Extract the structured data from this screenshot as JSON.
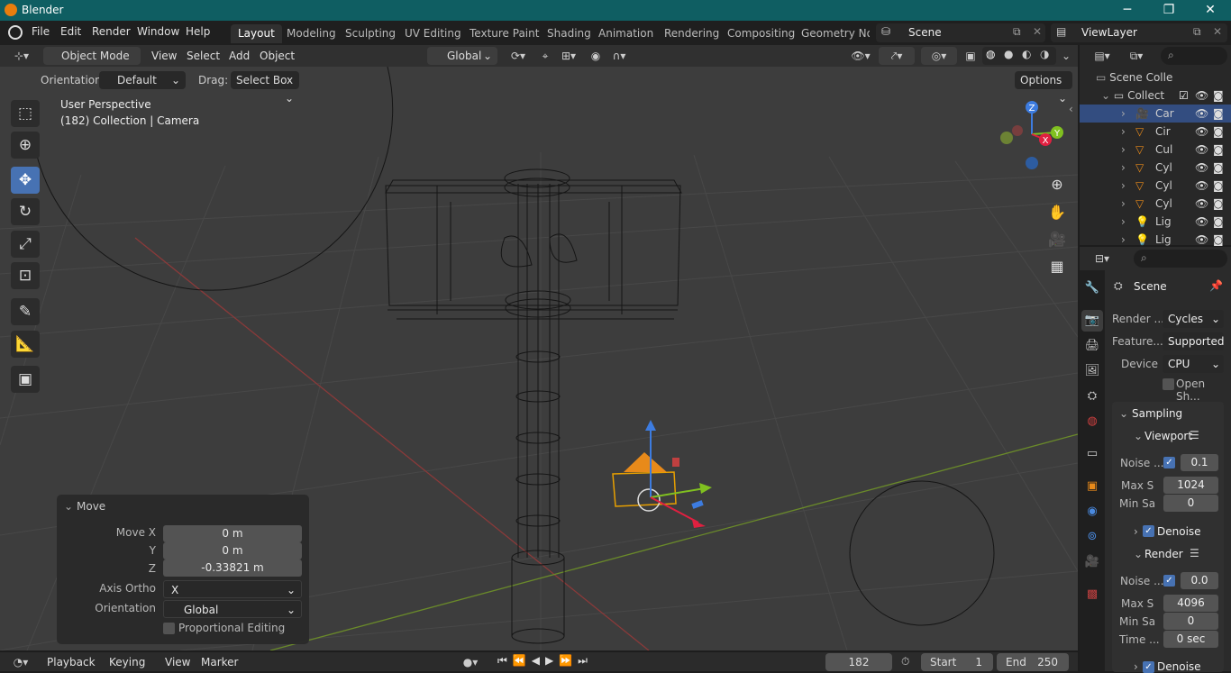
{
  "app": {
    "title": "Blender",
    "win_min": "─",
    "win_max": "❐",
    "win_close": "✕"
  },
  "menu": [
    "File",
    "Edit",
    "Render",
    "Window",
    "Help"
  ],
  "workspaces": [
    "Layout",
    "Modeling",
    "Sculpting",
    "UV Editing",
    "Texture Paint",
    "Shading",
    "Animation",
    "Rendering",
    "Compositing",
    "Geometry Noc"
  ],
  "scene_name": "Scene",
  "view_layer": "ViewLayer",
  "header3d": {
    "mode": "Object Mode",
    "menus": [
      "View",
      "Select",
      "Add",
      "Object"
    ],
    "transform": "Global"
  },
  "header3d2": {
    "orientation_label": "Orientation:",
    "orientation_value": "Default",
    "drag_label": "Drag:",
    "drag_value": "Select Box",
    "options": "Options"
  },
  "viewport": {
    "perspective": "User Perspective",
    "context": "(182) Collection | Camera"
  },
  "gizmo": {
    "z": "Z",
    "y": "Y",
    "x": "X"
  },
  "operator_panel": {
    "title": "Move",
    "move_x_label": "Move X",
    "move_x": "0 m",
    "y_label": "Y",
    "y": "0 m",
    "z_label": "Z",
    "z": "-0.33821 m",
    "axis_ortho_label": "Axis Ortho",
    "axis_ortho": "X",
    "orientation_label": "Orientation",
    "orientation": "Global",
    "proportional": "Proportional Editing"
  },
  "timeline": {
    "menus": [
      "Playback",
      "Keying",
      "View",
      "Marker"
    ],
    "frame": "182",
    "start_label": "Start",
    "start": "1",
    "end_label": "End",
    "end": "250"
  },
  "outliner": {
    "root": "Scene Colle",
    "collection": "Collect",
    "items": [
      {
        "name": "Car",
        "icon": "camera-icon",
        "selected": true
      },
      {
        "name": "Cir",
        "icon": "mesh-icon"
      },
      {
        "name": "Cul",
        "icon": "mesh-icon"
      },
      {
        "name": "Cyl",
        "icon": "mesh-icon"
      },
      {
        "name": "Cyl",
        "icon": "mesh-icon"
      },
      {
        "name": "Cyl",
        "icon": "mesh-icon"
      },
      {
        "name": "Lig",
        "icon": "light-icon"
      },
      {
        "name": "Lig",
        "icon": "light-icon"
      }
    ]
  },
  "properties": {
    "context": "Scene",
    "render_engine_label": "Render ...",
    "render_engine": "Cycles",
    "feature_label": "Feature...",
    "feature": "Supported",
    "device_label": "Device",
    "device": "CPU",
    "open_shading": "Open Sh...",
    "sampling": "Sampling",
    "viewport": "Viewport",
    "noise_label": "Noise ...",
    "vp_noise": "0.1",
    "max_label": "Max S",
    "vp_max": "1024",
    "min_label": "Min Sa",
    "vp_min": "0",
    "denoise": "Denoise",
    "render": "Render",
    "r_noise": "0.0",
    "r_max": "4096",
    "r_min": "0",
    "time_label": "Time ...",
    "r_time": "0 sec",
    "denoise2": "Denoise"
  }
}
